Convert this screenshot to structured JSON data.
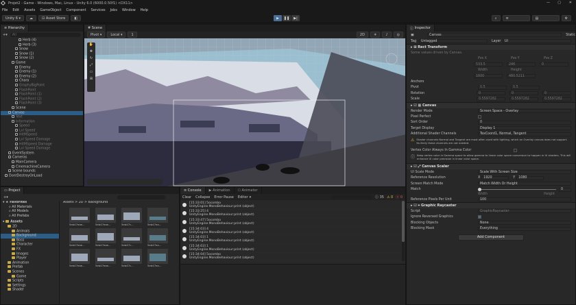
{
  "window_title": "Projet2 - Game - Windows, Mac, Linux - Unity 6.0 (6000.0.50f1) <DX11>",
  "menu": [
    "File",
    "Edit",
    "Assets",
    "GameObject",
    "Component",
    "Services",
    "Jobs",
    "Window",
    "Help"
  ],
  "toolbar": {
    "project": "Unity 6",
    "asset_store": "Asset Store",
    "dropdown_arrow": "▾"
  },
  "hierarchy": {
    "tab": "Hierarchy",
    "search_placeholder": "All",
    "items": [
      {
        "t": "Herb (4)",
        "d": 6
      },
      {
        "t": "Herb (3)",
        "d": 6
      },
      {
        "t": "Snow",
        "d": 5
      },
      {
        "t": "Snow (1)",
        "d": 5
      },
      {
        "t": "Snow (2)",
        "d": 5
      },
      {
        "t": "Game",
        "d": 4
      },
      {
        "t": "Enemy",
        "d": 5
      },
      {
        "t": "Enemy (1)",
        "d": 5
      },
      {
        "t": "Enemy (2)",
        "d": 5
      },
      {
        "t": "Chara",
        "d": 5
      },
      {
        "t": "GraphyBigPoint",
        "d": 5,
        "dim": true
      },
      {
        "t": "FlashPoint",
        "d": 5,
        "dim": true
      },
      {
        "t": "FlashPoint (1)",
        "d": 5,
        "dim": true
      },
      {
        "t": "FlashPoint (2)",
        "d": 5,
        "dim": true
      },
      {
        "t": "FlashPoint (3)",
        "d": 5,
        "dim": true
      },
      {
        "t": "Scene",
        "d": 4
      },
      {
        "t": "Canvas",
        "d": 3,
        "sel": true
      },
      {
        "t": "Text",
        "d": 4,
        "dim": true
      },
      {
        "t": "Information",
        "d": 4,
        "dim": true
      },
      {
        "t": "Speed",
        "d": 5,
        "dim": true
      },
      {
        "t": "Lvl Speed",
        "d": 5,
        "dim": true
      },
      {
        "t": "HitMSpeed",
        "d": 5,
        "dim": true
      },
      {
        "t": "Lvl Speed Damage",
        "d": 5,
        "dim": true
      },
      {
        "t": "HitMSpeed Damage",
        "d": 5,
        "dim": true
      },
      {
        "t": "Lvl Speed Damage",
        "d": 5,
        "dim": true
      },
      {
        "t": "EventSystem",
        "d": 3
      },
      {
        "t": "Cameras",
        "d": 3
      },
      {
        "t": "MainCamera",
        "d": 4
      },
      {
        "t": "CinemachineCamera",
        "d": 4
      },
      {
        "t": "Scene bounds",
        "d": 3
      },
      {
        "t": "DontDestroyOnLoad",
        "d": 2
      }
    ]
  },
  "scene": {
    "tab": "Scene",
    "pivot": "Pivot",
    "local": "Local",
    "grid_value": "1",
    "mode_2d": "2D"
  },
  "inspector": {
    "tab": "Inspector",
    "object_name": "Canvas",
    "static_label": "Static",
    "tag_label": "Tag",
    "tag_value": "Untagged",
    "layer_label": "Layer",
    "layer_value": "UI",
    "rect_transform": {
      "title": "Rect Transform",
      "note": "Some values driven by Canvas.",
      "pos_x_label": "Pos X",
      "pos_y_label": "Pos Y",
      "pos_z_label": "Pos Z",
      "pos_x": "533.5",
      "pos_y": "246",
      "pos_z": "0",
      "width_label": "Width",
      "height_label": "Height",
      "width": "1600",
      "height": "480.5211",
      "anchors": "Anchors",
      "pivot": "Pivot",
      "pivot_x": "0.5",
      "pivot_y": "0.5",
      "rotation": "Rotation",
      "rot_x": "0",
      "rot_y": "0",
      "rot_z": "0",
      "scale": "Scale",
      "scale_x": "0.5597282",
      "scale_y": "0.5597282",
      "scale_z": "0.5597282"
    },
    "canvas": {
      "title": "Canvas",
      "render_mode_label": "Render Mode",
      "render_mode": "Screen Space - Overlay",
      "pixel_perfect": "Pixel Perfect",
      "sort_order_label": "Sort Order",
      "sort_order": "0",
      "target_display_label": "Target Display",
      "target_display": "Display 1",
      "shader_channels_label": "Additional Shader Channels",
      "shader_channels": "TexCoord1, Normal, Tangent",
      "warn1": "Shader channels Normal and Tangent are most often used with lighting, which an Overlay canvas does not support. Its likely these channels are not needed.",
      "vertex_gamma": "Vertex Color Always In Gamma Color",
      "warn2": "Keep vertex color in Gamma space to allow gamma to linear color space conversion to happen in UI shaders. This will enhance UI color precision in linear color space."
    },
    "scaler": {
      "title": "Canvas Scaler",
      "ui_scale_mode_label": "UI Scale Mode",
      "ui_scale_mode": "Scale With Screen Size",
      "ref_res_label": "Reference Resolution",
      "ref_x": "1920",
      "ref_y": "1080",
      "x": "X",
      "y": "Y",
      "match_mode_label": "Screen Match Mode",
      "match_mode": "Match Width Or Height",
      "match_label": "Match",
      "match_value": "0",
      "width_label": "Width",
      "height_label": "Height",
      "ppu_label": "Reference Pixels Per Unit",
      "ppu": "100"
    },
    "raycaster": {
      "title": "Graphic Raycaster",
      "script_label": "Script",
      "script": "GraphicRaycaster",
      "ignore_label": "Ignore Reversed Graphics",
      "blocking_objects_label": "Blocking Objects",
      "blocking_objects": "None",
      "blocking_mask_label": "Blocking Mask",
      "blocking_mask": "Everything"
    },
    "add_component": "Add Component"
  },
  "project": {
    "tab": "Project",
    "favorites": "Favorites",
    "fav_items": [
      "All Materials",
      "All Models",
      "All Prefabs"
    ],
    "assets": "Assets",
    "folders": [
      {
        "t": "2D",
        "d": 1
      },
      {
        "t": "Animals",
        "d": 2
      },
      {
        "t": "Background",
        "d": 2,
        "sel": true
      },
      {
        "t": "Boss",
        "d": 2
      },
      {
        "t": "Character",
        "d": 2
      },
      {
        "t": "FX",
        "d": 2
      },
      {
        "t": "Images",
        "d": 2
      },
      {
        "t": "Player",
        "d": 2
      },
      {
        "t": "Animation",
        "d": 1
      },
      {
        "t": "Prefab",
        "d": 1
      },
      {
        "t": "Scenes",
        "d": 1
      },
      {
        "t": "Game",
        "d": 2
      },
      {
        "t": "Scripts",
        "d": 1
      },
      {
        "t": "Settings",
        "d": 1
      },
      {
        "t": "Shader",
        "d": 1
      }
    ],
    "breadcrumb": [
      "Assets",
      "2D",
      "Background"
    ],
    "thumb_labels": [
      "5eb47eae...",
      "5eb47eae...",
      "5eb47c...",
      "5eb47ea...",
      "5eb47eae...",
      "5eb47eae...",
      "5eb47c...",
      "5eb47ea...",
      "5eb47eae...",
      "5eb47eae...",
      "5eb47c...",
      "5eb47ea..."
    ]
  },
  "console": {
    "tabs": [
      "Console",
      "Animation",
      "Animator"
    ],
    "clear": "Clear",
    "collapse": "Collapse",
    "error_pause": "Error Pause",
    "editor": "Editor",
    "counts": [
      "35",
      "0",
      "0"
    ],
    "entries": [
      {
        "a": "[15:33:01] 5ocombo",
        "b": "UnityEngine.MonoBehaviour:print (object)"
      },
      {
        "a": "[15:33:25] 4",
        "b": "UnityEngine.MonoBehaviour:print (object)"
      },
      {
        "a": "[15:33:47] 5ocombo",
        "b": "UnityEngine.MonoBehaviour:print (object)"
      },
      {
        "a": "[15:34:03] 4",
        "b": "UnityEngine.MonoBehaviour:print (object)"
      },
      {
        "a": "[15:34:03] 1",
        "b": "UnityEngine.MonoBehaviour:print (object)"
      },
      {
        "a": "[15:34:03] 1",
        "b": "UnityEngine.MonoBehaviour:print (object)"
      },
      {
        "a": "[15:34:04] 5ocombo",
        "b": "UnityEngine.MonoBehaviour:print (object)"
      }
    ]
  }
}
